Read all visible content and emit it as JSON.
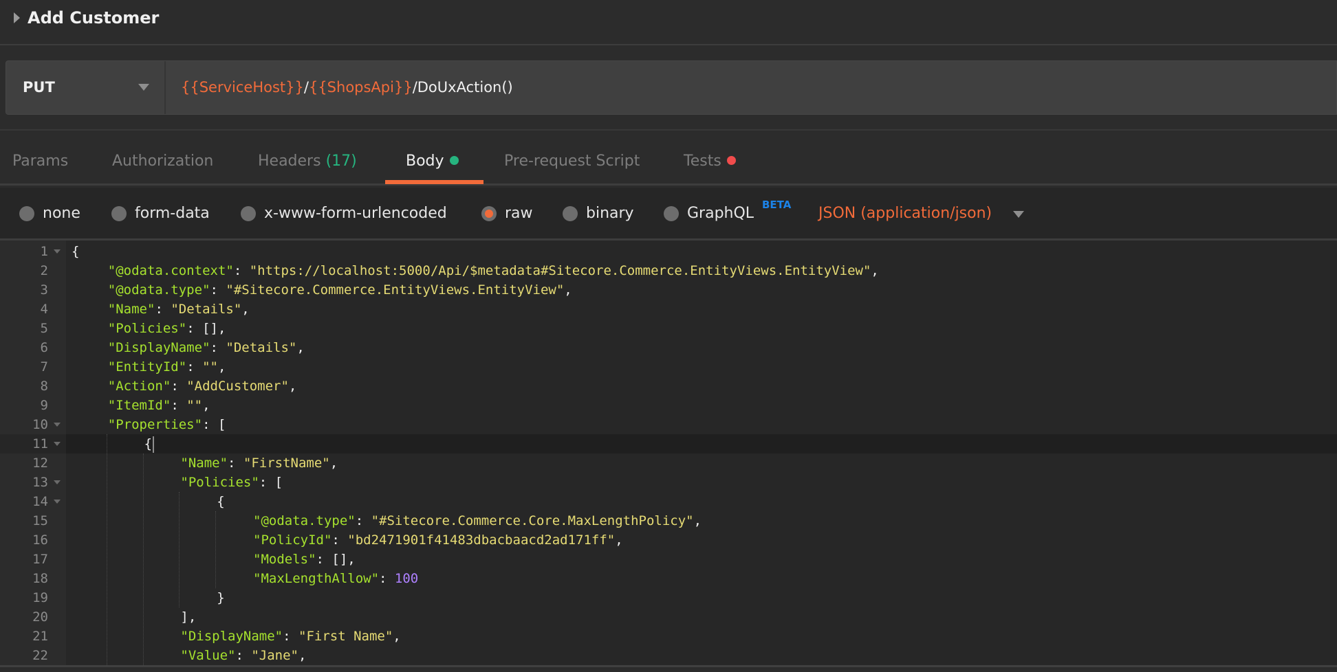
{
  "request": {
    "title": "Add Customer",
    "method": "PUT",
    "url_parts": [
      {
        "text": "{{ServiceHost}}",
        "type": "variable"
      },
      {
        "text": "/",
        "type": "plain"
      },
      {
        "text": "{{ShopsApi}}",
        "type": "variable"
      },
      {
        "text": "/DoUxAction()",
        "type": "plain"
      }
    ]
  },
  "tabs": [
    {
      "label": "Params",
      "active": false
    },
    {
      "label": "Authorization",
      "active": false
    },
    {
      "label": "Headers",
      "count": "(17)",
      "active": false
    },
    {
      "label": "Body",
      "active": true,
      "indicator_color": "#26b47f"
    },
    {
      "label": "Pre-request Script",
      "active": false
    },
    {
      "label": "Tests",
      "active": false,
      "indicator_color": "#f14c4c"
    }
  ],
  "body_types": [
    {
      "label": "none",
      "selected": false
    },
    {
      "label": "form-data",
      "selected": false
    },
    {
      "label": "x-www-form-urlencoded",
      "selected": false
    },
    {
      "label": "raw",
      "selected": true
    },
    {
      "label": "binary",
      "selected": false
    },
    {
      "label": "GraphQL",
      "selected": false,
      "badge": "BETA"
    }
  ],
  "content_type": "JSON (application/json)",
  "colors": {
    "accent": "#f26b3a",
    "variable": "#f26b3a",
    "count": "#26b47f",
    "beta": "#1c83e8",
    "json_key": "#a6e22e",
    "json_string": "#e6db74",
    "json_number": "#ae81ff"
  },
  "editor": {
    "active_line": 11,
    "lines": [
      {
        "n": 1,
        "fold": true,
        "indent": 0,
        "tokens": [
          [
            "p",
            "{"
          ]
        ]
      },
      {
        "n": 2,
        "indent": 1,
        "tokens": [
          [
            "k",
            "\"@odata.context\""
          ],
          [
            "p",
            ": "
          ],
          [
            "s",
            "\"https://localhost:5000/Api/$metadata#Sitecore.Commerce.EntityViews.EntityView\""
          ],
          [
            "p",
            ","
          ]
        ]
      },
      {
        "n": 3,
        "indent": 1,
        "tokens": [
          [
            "k",
            "\"@odata.type\""
          ],
          [
            "p",
            ": "
          ],
          [
            "s",
            "\"#Sitecore.Commerce.EntityViews.EntityView\""
          ],
          [
            "p",
            ","
          ]
        ]
      },
      {
        "n": 4,
        "indent": 1,
        "tokens": [
          [
            "k",
            "\"Name\""
          ],
          [
            "p",
            ": "
          ],
          [
            "s",
            "\"Details\""
          ],
          [
            "p",
            ","
          ]
        ]
      },
      {
        "n": 5,
        "indent": 1,
        "tokens": [
          [
            "k",
            "\"Policies\""
          ],
          [
            "p",
            ": [],"
          ]
        ]
      },
      {
        "n": 6,
        "indent": 1,
        "tokens": [
          [
            "k",
            "\"DisplayName\""
          ],
          [
            "p",
            ": "
          ],
          [
            "s",
            "\"Details\""
          ],
          [
            "p",
            ","
          ]
        ]
      },
      {
        "n": 7,
        "indent": 1,
        "tokens": [
          [
            "k",
            "\"EntityId\""
          ],
          [
            "p",
            ": "
          ],
          [
            "s",
            "\"\""
          ],
          [
            "p",
            ","
          ]
        ]
      },
      {
        "n": 8,
        "indent": 1,
        "tokens": [
          [
            "k",
            "\"Action\""
          ],
          [
            "p",
            ": "
          ],
          [
            "s",
            "\"AddCustomer\""
          ],
          [
            "p",
            ","
          ]
        ]
      },
      {
        "n": 9,
        "indent": 1,
        "tokens": [
          [
            "k",
            "\"ItemId\""
          ],
          [
            "p",
            ": "
          ],
          [
            "s",
            "\"\""
          ],
          [
            "p",
            ","
          ]
        ]
      },
      {
        "n": 10,
        "fold": true,
        "indent": 1,
        "tokens": [
          [
            "k",
            "\"Properties\""
          ],
          [
            "p",
            ": ["
          ]
        ]
      },
      {
        "n": 11,
        "fold": true,
        "indent": 2,
        "tokens": [
          [
            "p",
            "{"
          ]
        ],
        "cursor": true
      },
      {
        "n": 12,
        "indent": 3,
        "tokens": [
          [
            "k",
            "\"Name\""
          ],
          [
            "p",
            ": "
          ],
          [
            "s",
            "\"FirstName\""
          ],
          [
            "p",
            ","
          ]
        ]
      },
      {
        "n": 13,
        "fold": true,
        "indent": 3,
        "tokens": [
          [
            "k",
            "\"Policies\""
          ],
          [
            "p",
            ": ["
          ]
        ]
      },
      {
        "n": 14,
        "fold": true,
        "indent": 4,
        "tokens": [
          [
            "p",
            "{"
          ]
        ]
      },
      {
        "n": 15,
        "indent": 5,
        "tokens": [
          [
            "k",
            "\"@odata.type\""
          ],
          [
            "p",
            ": "
          ],
          [
            "s",
            "\"#Sitecore.Commerce.Core.MaxLengthPolicy\""
          ],
          [
            "p",
            ","
          ]
        ]
      },
      {
        "n": 16,
        "indent": 5,
        "tokens": [
          [
            "k",
            "\"PolicyId\""
          ],
          [
            "p",
            ": "
          ],
          [
            "s",
            "\"bd2471901f41483dbacbaacd2ad171ff\""
          ],
          [
            "p",
            ","
          ]
        ]
      },
      {
        "n": 17,
        "indent": 5,
        "tokens": [
          [
            "k",
            "\"Models\""
          ],
          [
            "p",
            ": [],"
          ]
        ]
      },
      {
        "n": 18,
        "indent": 5,
        "tokens": [
          [
            "k",
            "\"MaxLengthAllow\""
          ],
          [
            "p",
            ": "
          ],
          [
            "n",
            "100"
          ]
        ]
      },
      {
        "n": 19,
        "indent": 4,
        "tokens": [
          [
            "p",
            "}"
          ]
        ]
      },
      {
        "n": 20,
        "indent": 3,
        "tokens": [
          [
            "p",
            "],"
          ]
        ]
      },
      {
        "n": 21,
        "indent": 3,
        "tokens": [
          [
            "k",
            "\"DisplayName\""
          ],
          [
            "p",
            ": "
          ],
          [
            "s",
            "\"First Name\""
          ],
          [
            "p",
            ","
          ]
        ]
      },
      {
        "n": 22,
        "indent": 3,
        "tokens": [
          [
            "k",
            "\"Value\""
          ],
          [
            "p",
            ": "
          ],
          [
            "s",
            "\"Jane\""
          ],
          [
            "p",
            ","
          ]
        ]
      }
    ]
  }
}
